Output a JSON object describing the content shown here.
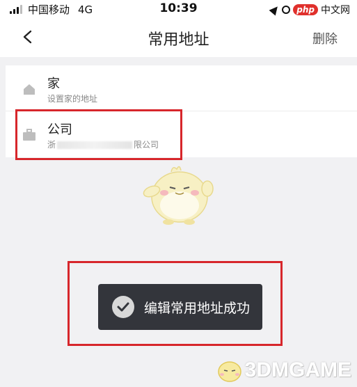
{
  "status_bar": {
    "carrier": "中国移动",
    "network": "4G",
    "time": "10:39",
    "watermark_badge": "php",
    "watermark_text": "中文网"
  },
  "nav": {
    "title": "常用地址",
    "delete_label": "删除",
    "back_icon": "chevron-left-icon"
  },
  "addresses": [
    {
      "title": "家",
      "subtitle": "设置家的地址",
      "icon": "home-icon"
    },
    {
      "title": "公司",
      "subtitle_prefix": "浙",
      "subtitle_suffix": "限公司",
      "icon": "briefcase-icon"
    }
  ],
  "toast": {
    "message": "编辑常用地址成功",
    "icon": "check-circle-icon"
  },
  "watermark": {
    "brand": "3DMGAME"
  },
  "colors": {
    "annotation": "#d7262b",
    "toast_bg": "#33353b",
    "page_bg": "#f1f1f3"
  }
}
